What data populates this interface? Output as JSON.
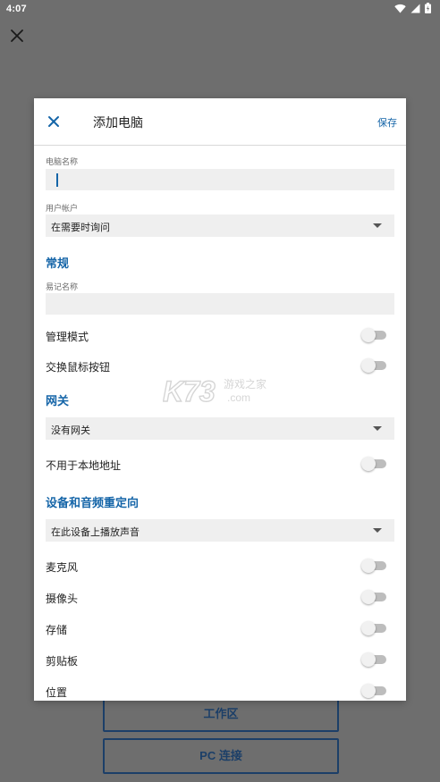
{
  "status_bar": {
    "time": "4:07",
    "icons": [
      "wifi-icon",
      "cell-signal-icon",
      "battery-icon"
    ]
  },
  "background": {
    "close_icon": "close-icon",
    "workspace_button": "工作区",
    "pc_connect_button": "PC 连接"
  },
  "dialog": {
    "title": "添加电脑",
    "save_label": "保存",
    "computer_name": {
      "label": "电脑名称",
      "value": ""
    },
    "user_account": {
      "label": "用户帐户",
      "selected": "在需要时询问"
    },
    "general": {
      "heading": "常规",
      "friendly_name": {
        "label": "易记名称",
        "value": ""
      },
      "admin_mode": {
        "label": "管理模式",
        "on": false
      },
      "swap_mouse": {
        "label": "交换鼠标按钮",
        "on": false
      }
    },
    "gateway": {
      "heading": "网关",
      "selected": "没有网关",
      "bypass_local": {
        "label": "不用于本地地址",
        "on": false
      }
    },
    "redirection": {
      "heading": "设备和音频重定向",
      "sound_selected": "在此设备上播放声音",
      "microphone": {
        "label": "麦克风",
        "on": false
      },
      "camera": {
        "label": "摄像头",
        "on": false
      },
      "storage": {
        "label": "存储",
        "on": false
      },
      "clipboard": {
        "label": "剪贴板",
        "on": false
      },
      "location": {
        "label": "位置",
        "on": false
      }
    }
  },
  "watermark": {
    "logo": "K73",
    "text_line1": "游戏之家",
    "text_line2": ".com"
  },
  "colors": {
    "accent": "#1565a8",
    "scrim": "#6e6e6e",
    "input_bg": "#efefef",
    "toggle_off_track": "#bdbdbd",
    "bg_button_border": "#1c3f68"
  }
}
